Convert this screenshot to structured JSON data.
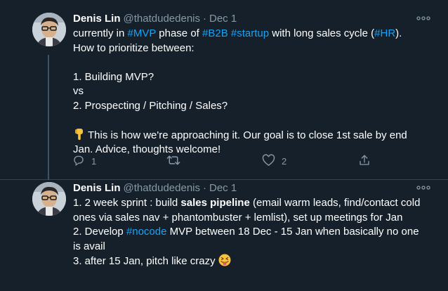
{
  "tweets": [
    {
      "author": "Denis Lin",
      "handle": "@thatdudedenis",
      "separator": "·",
      "date": "Dec 1",
      "line1": {
        "pre": "currently in ",
        "tag1": "#MVP",
        "mid1": " phase of ",
        "tag2": "#B2B",
        "mid2": " ",
        "tag3": "#startup",
        "mid3": " with long sales cycle (",
        "tag4": "#HR",
        "post": ")."
      },
      "line2": "How to prioritize between:",
      "line3": "1. Building MVP?",
      "line4": "vs",
      "line5": "2. Prospecting / Pitching / Sales?",
      "line6": "This is how we're approaching it. Our goal is to close 1st sale by end",
      "line7": "Jan. Advice, thoughts welcome!",
      "emoji_icon": "pointing-down-hand",
      "replies": "1",
      "likes": "2"
    },
    {
      "author": "Denis Lin",
      "handle": "@thatdudedenis",
      "separator": "·",
      "date": "Dec 1",
      "p1_pre": "1. 2 week sprint : build ",
      "p1_bold": "sales pipeline",
      "p1_post": " (email warm leads, find/contact cold",
      "p1_line2": "ones via sales nav + phantombuster + lemlist), set up meetings for Jan",
      "p2_pre": "2. Develop ",
      "p2_tag": "#nocode",
      "p2_post": " MVP between 18 Dec - 15 Jan when basically no one",
      "p2_line2": "is avail",
      "p3": "3. after 15 Jan, pitch like crazy",
      "emoji_icon": "squinting-tongue-face"
    }
  ],
  "colors": {
    "background": "#15202b",
    "link": "#1da1f2",
    "secondary_text": "#8899a6",
    "divider": "#38444d"
  },
  "icons": [
    "more-icon",
    "reply-icon",
    "retweet-icon",
    "like-icon",
    "share-icon"
  ]
}
